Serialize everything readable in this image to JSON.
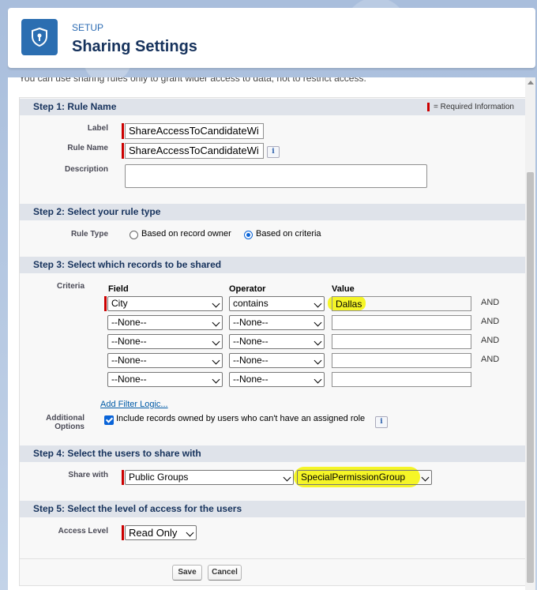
{
  "header": {
    "section": "SETUP",
    "title": "Sharing Settings"
  },
  "intro_text": "You can use sharing rules only to grant wider access to data, not to restrict access.",
  "step1": {
    "title": "Step 1: Rule Name",
    "required_info": "= Required Information",
    "label_label": "Label",
    "label_value": "ShareAccessToCandidateWi",
    "rule_name_label": "Rule Name",
    "rule_name_value": "ShareAccessToCandidateWi",
    "description_label": "Description",
    "description_value": ""
  },
  "step2": {
    "title": "Step 2: Select your rule type",
    "rule_type_label": "Rule Type",
    "option_owner": "Based on record owner",
    "option_criteria": "Based on criteria",
    "selected": "Based on criteria"
  },
  "step3": {
    "title": "Step 3: Select which records to be shared",
    "criteria_label": "Criteria",
    "col_field": "Field",
    "col_operator": "Operator",
    "col_value": "Value",
    "rows": [
      {
        "field": "City",
        "operator": "contains",
        "value": "Dallas",
        "conj": "AND"
      },
      {
        "field": "--None--",
        "operator": "--None--",
        "value": "",
        "conj": "AND"
      },
      {
        "field": "--None--",
        "operator": "--None--",
        "value": "",
        "conj": "AND"
      },
      {
        "field": "--None--",
        "operator": "--None--",
        "value": "",
        "conj": "AND"
      },
      {
        "field": "--None--",
        "operator": "--None--",
        "value": "",
        "conj": ""
      }
    ],
    "add_filter_logic": "Add Filter Logic...",
    "additional_label_1": "Additional",
    "additional_label_2": "Options",
    "include_records_text": "Include records owned by users who can't have an assigned role",
    "include_records_checked": true
  },
  "step4": {
    "title": "Step 4: Select the users to share with",
    "share_with_label": "Share with",
    "share_type": "Public Groups",
    "share_target": "SpecialPermissionGroup"
  },
  "step5": {
    "title": "Step 5: Select the level of access for the users",
    "access_level_label": "Access Level",
    "access_level": "Read Only"
  },
  "buttons": {
    "save": "Save",
    "cancel": "Cancel"
  },
  "colors": {
    "highlight": "#f5f527",
    "required": "#cc0000",
    "brand": "#2b6eb1"
  }
}
